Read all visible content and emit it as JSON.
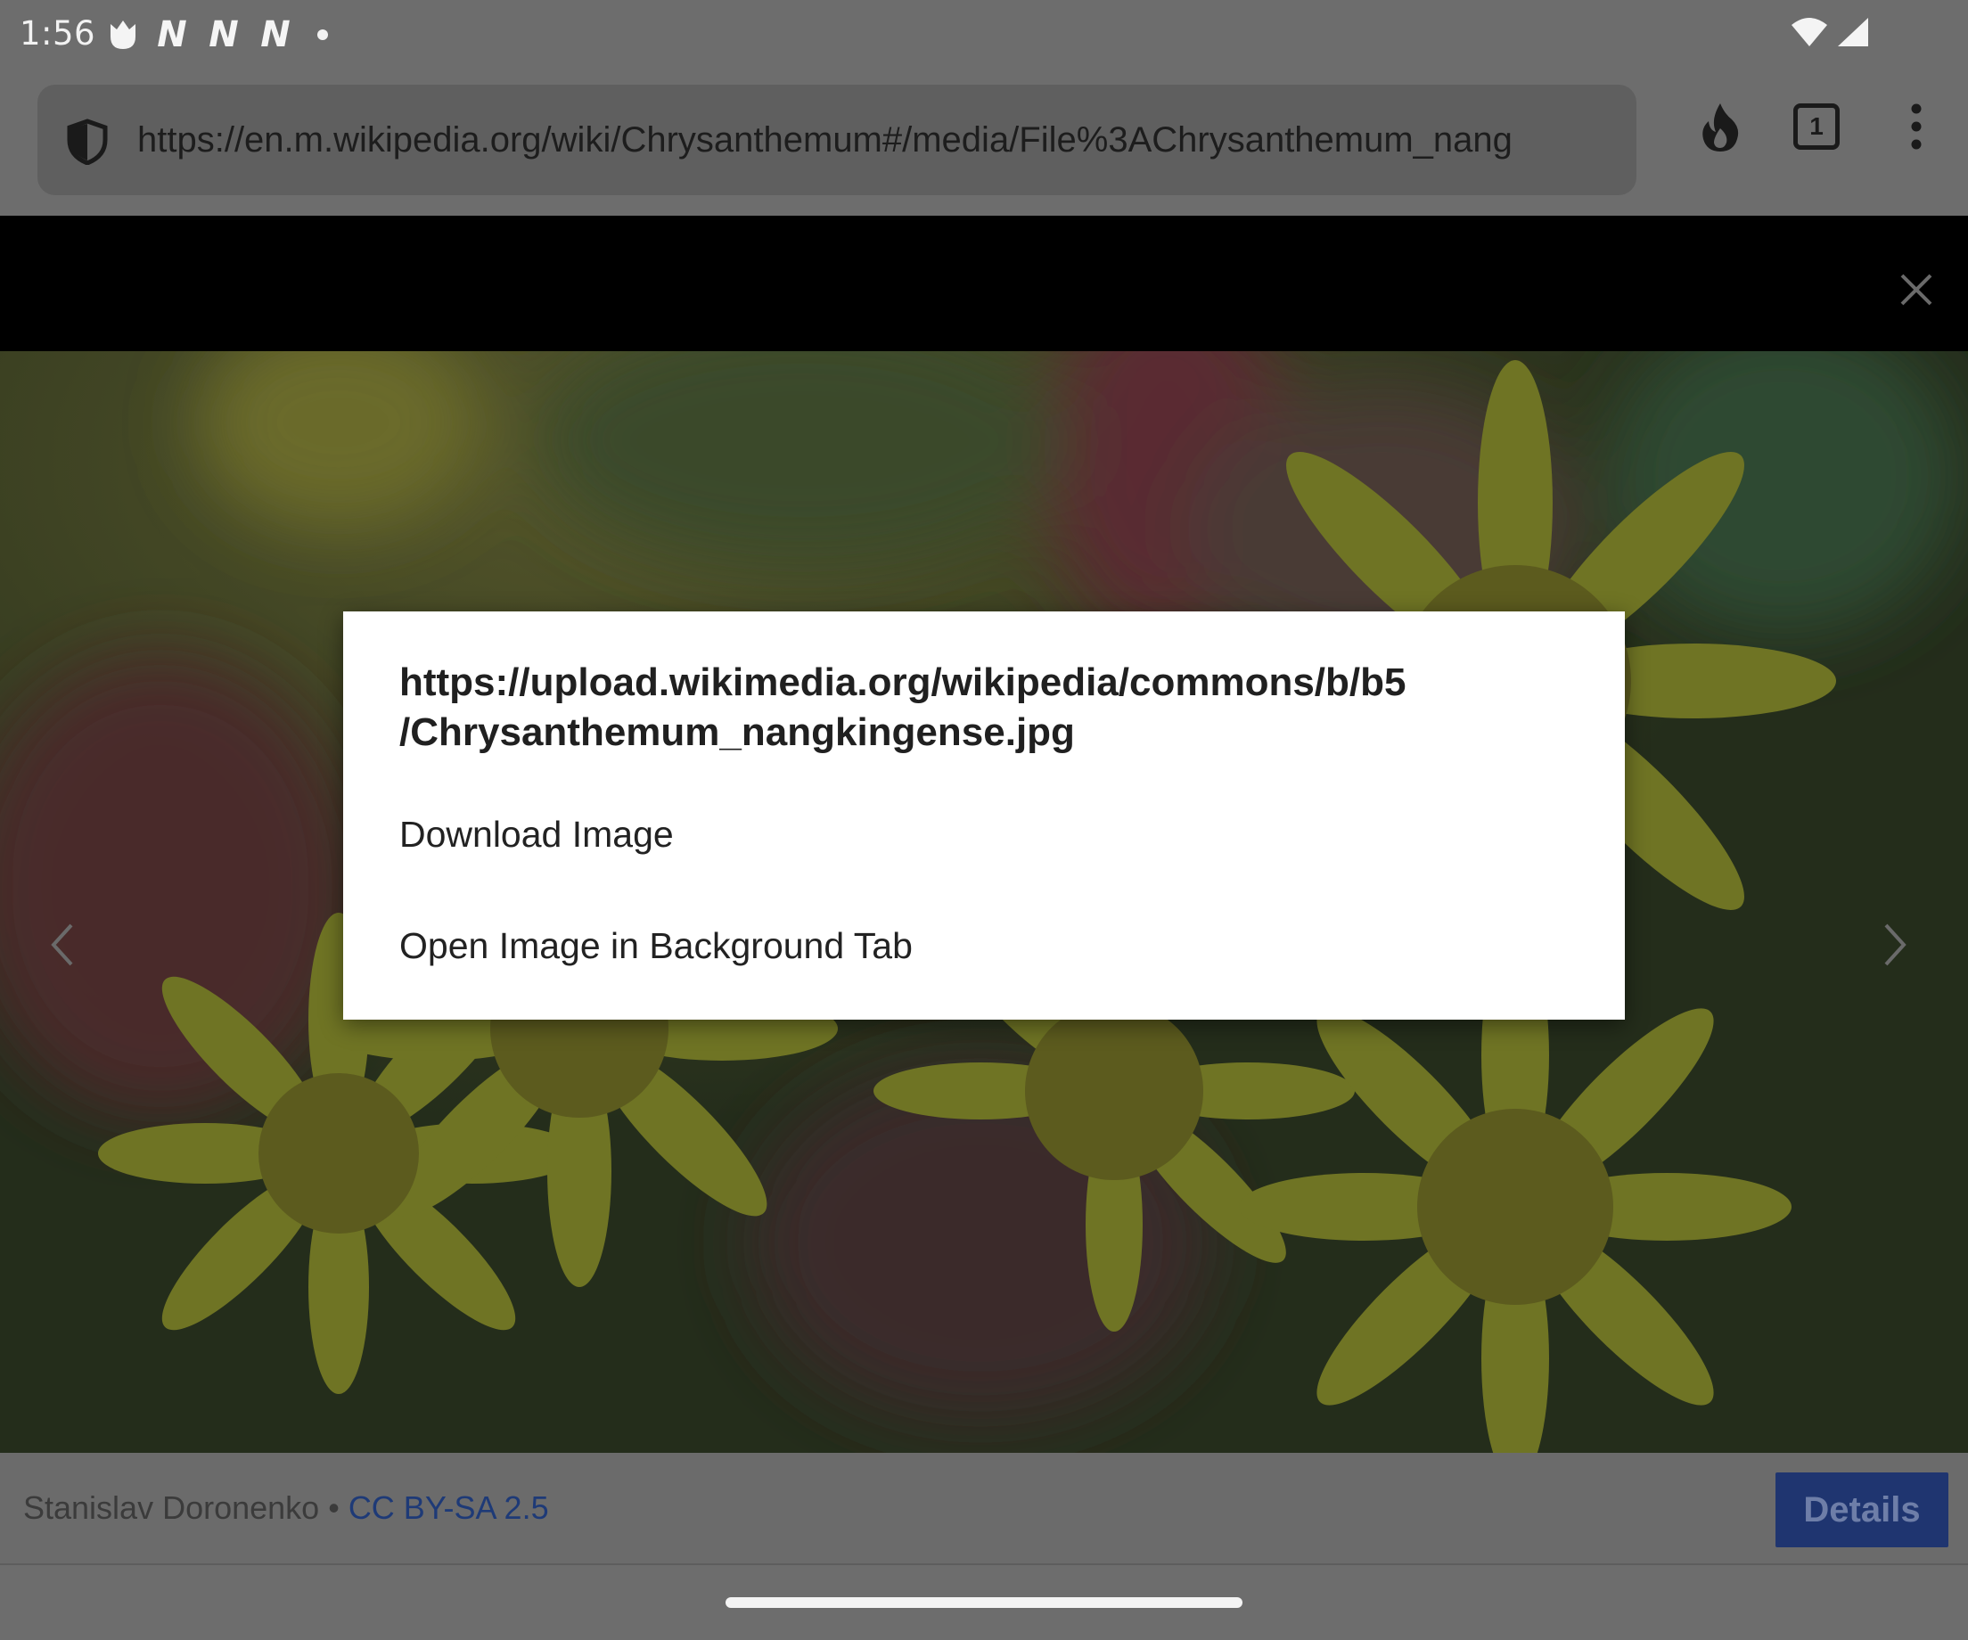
{
  "status_bar": {
    "time": "1:56",
    "notification_glyphs": [
      "N",
      "N",
      "N"
    ],
    "icons": [
      "tulip-app-icon",
      "wifi-icon",
      "cellular-signal-icon"
    ]
  },
  "toolbar": {
    "url": "https://en.m.wikipedia.org/wiki/Chrysanthemum#/media/File%3AChrysanthemum_nang",
    "tab_count": "1",
    "icons": [
      "shield-icon",
      "fire-icon",
      "tab-counter-icon",
      "overflow-menu-icon"
    ]
  },
  "dialog": {
    "title": "https://upload.wikimedia.org/wikipedia/commons/b/b5/Chrysanthemum_nangkingense.jpg",
    "title_line1": "https://upload.wikimedia.org/wikipedia/commons/b/b5",
    "title_line2": "/Chrysanthemum_nangkingense.jpg",
    "items": [
      {
        "label": "Download Image"
      },
      {
        "label": "Open Image in Background Tab"
      }
    ]
  },
  "footer": {
    "author": "Stanislav Doronenko",
    "separator": " • ",
    "license": "CC BY-SA 2.5",
    "details_label": "Details"
  },
  "colors": {
    "scrim": "#6d6d6d",
    "dialog_bg": "#ffffff",
    "details_button": "#1f3570",
    "license_link": "#1e3a77"
  }
}
